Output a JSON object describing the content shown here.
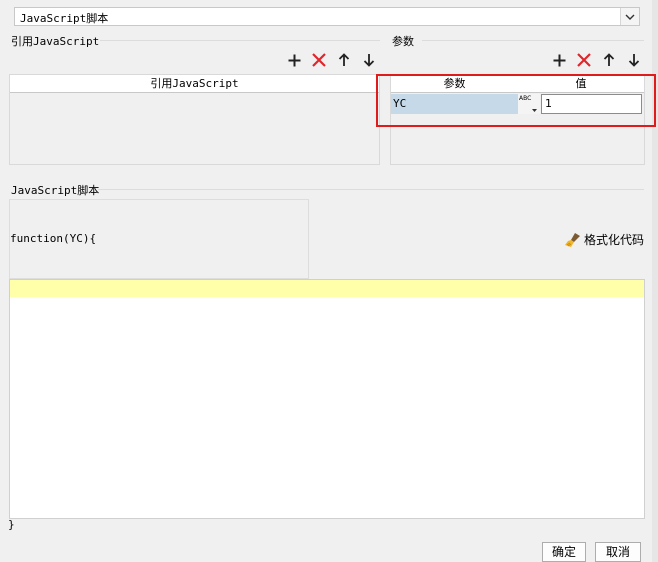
{
  "type_select": {
    "value": "JavaScript脚本"
  },
  "references": {
    "section_label": "引用JavaScript",
    "column_header": "引用JavaScript",
    "rows": []
  },
  "parameters": {
    "section_label": "参数",
    "columns": [
      "参数",
      "值"
    ],
    "rows": [
      {
        "name": "YC",
        "type_icon_text": "ABC",
        "value": "1"
      }
    ]
  },
  "script": {
    "section_label": "JavaScript脚本",
    "function_signature": "function(YC){",
    "body": "",
    "closing_brace": "}",
    "format_button": "格式化代码"
  },
  "dialog": {
    "ok_label": "确定",
    "cancel_label": "取消"
  },
  "colors": {
    "add": "#222222",
    "delete": "#e0262b",
    "highlight_border": "#e01b1b",
    "selected_cell": "#c5d9e8",
    "current_line": "#ffffaa"
  },
  "icons": [
    "chevron-down-icon",
    "plus-icon",
    "delete-icon",
    "arrow-up-icon",
    "arrow-down-icon",
    "text-type-icon",
    "brush-icon"
  ]
}
